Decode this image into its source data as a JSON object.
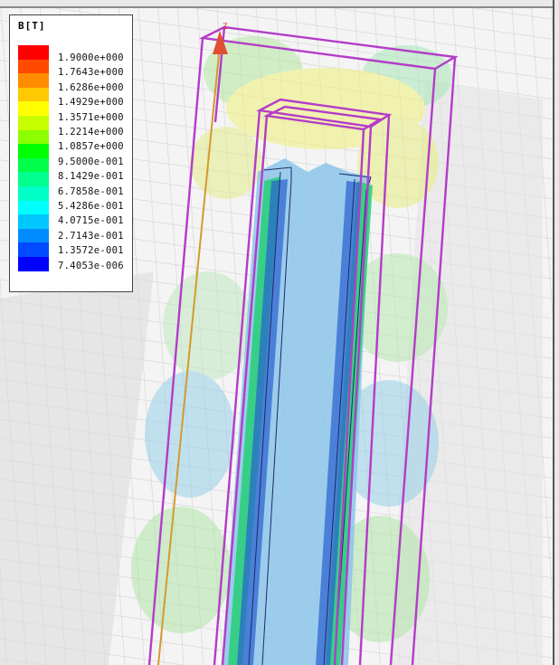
{
  "legend": {
    "title": "B[T]",
    "labels": [
      "1.9000e+000",
      "1.7643e+000",
      "1.6286e+000",
      "1.4929e+000",
      "1.3571e+000",
      "1.2214e+000",
      "1.0857e+000",
      "9.5000e-001",
      "8.1429e-001",
      "6.7858e-001",
      "5.4286e-001",
      "4.0715e-001",
      "2.7143e-001",
      "1.3572e-001",
      "7.4053e-006"
    ],
    "colors": [
      "#ff0000",
      "#ff4a00",
      "#ff8c00",
      "#ffc800",
      "#ffff00",
      "#c8ff00",
      "#8cff00",
      "#00ff00",
      "#00ff4a",
      "#00ff8c",
      "#00ffc8",
      "#00ffff",
      "#00c8ff",
      "#008cff",
      "#004aff",
      "#0000ff"
    ]
  },
  "axis": {
    "z_label": "Z"
  }
}
